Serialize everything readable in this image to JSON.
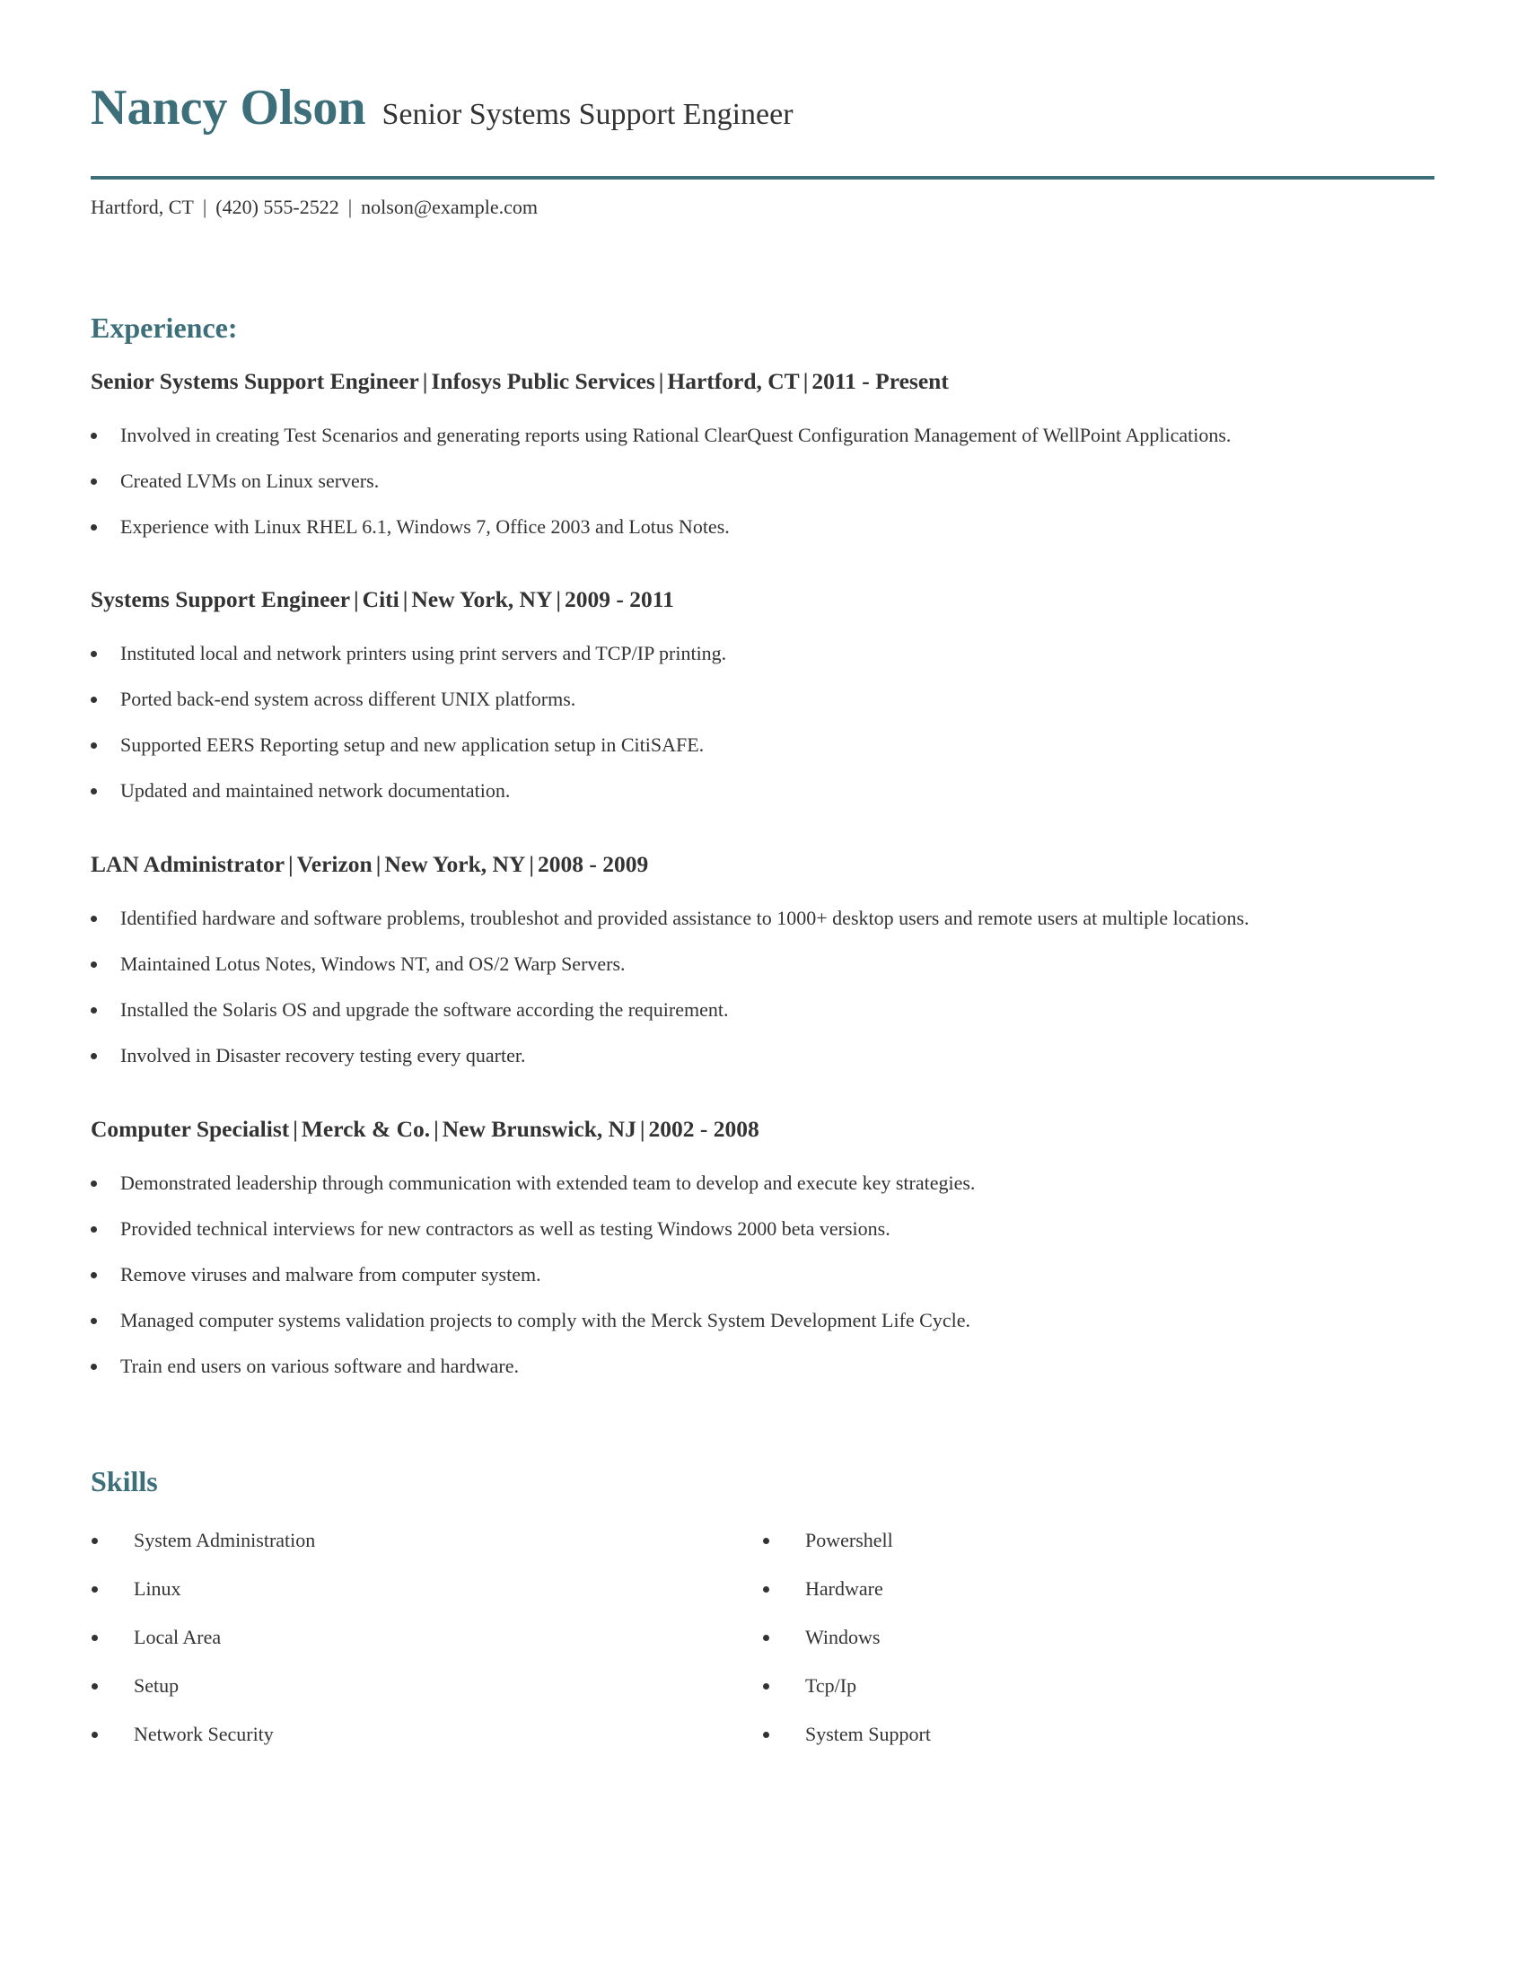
{
  "header": {
    "name": "Nancy Olson",
    "title": "Senior Systems Support Engineer",
    "contact": {
      "location": "Hartford, CT",
      "phone": "(420) 555-2522",
      "email": "nolson@example.com",
      "separator": "|"
    }
  },
  "colors": {
    "accent": "#3d6f7b",
    "text": "#333333"
  },
  "experience": {
    "heading": "Experience:",
    "jobs": [
      {
        "role": "Senior Systems Support Engineer",
        "company": "Infosys Public Services",
        "location": "Hartford, CT",
        "dates": "2011 - Present",
        "bullets": [
          "Involved in creating Test Scenarios and generating reports using Rational ClearQuest Configuration Management of WellPoint Applications.",
          "Created LVMs on Linux servers.",
          "Experience with Linux RHEL 6.1, Windows 7, Office 2003 and Lotus Notes."
        ]
      },
      {
        "role": "Systems Support Engineer",
        "company": "Citi",
        "location": "New York, NY",
        "dates": "2009 - 2011",
        "bullets": [
          "Instituted local and network printers using print servers and TCP/IP printing.",
          "Ported back-end system across different UNIX platforms.",
          "Supported EERS Reporting setup and new application setup in CitiSAFE.",
          "Updated and maintained network documentation."
        ]
      },
      {
        "role": "LAN Administrator",
        "company": "Verizon",
        "location": "New York, NY",
        "dates": "2008 - 2009",
        "bullets": [
          "Identified hardware and software problems, troubleshot and provided assistance to 1000+ desktop users and remote users at multiple locations.",
          "Maintained Lotus Notes, Windows NT, and OS/2 Warp Servers.",
          "Installed the Solaris OS and upgrade the software according the requirement.",
          "Involved in Disaster recovery testing every quarter."
        ]
      },
      {
        "role": "Computer Specialist",
        "company": "Merck & Co.",
        "location": "New Brunswick, NJ",
        "dates": "2002 - 2008",
        "bullets": [
          "Demonstrated leadership through communication with extended team to develop and execute key strategies.",
          "Provided technical interviews for new contractors as well as testing Windows 2000 beta versions.",
          "Remove viruses and malware from computer system.",
          "Managed computer systems validation projects to comply with the Merck System Development Life Cycle.",
          "Train end users on various software and hardware."
        ]
      }
    ]
  },
  "skills": {
    "heading": "Skills",
    "left": [
      "System Administration",
      "Linux",
      "Local Area",
      "Setup",
      "Network Security"
    ],
    "right": [
      "Powershell",
      "Hardware",
      "Windows",
      "Tcp/Ip",
      "System Support"
    ]
  }
}
